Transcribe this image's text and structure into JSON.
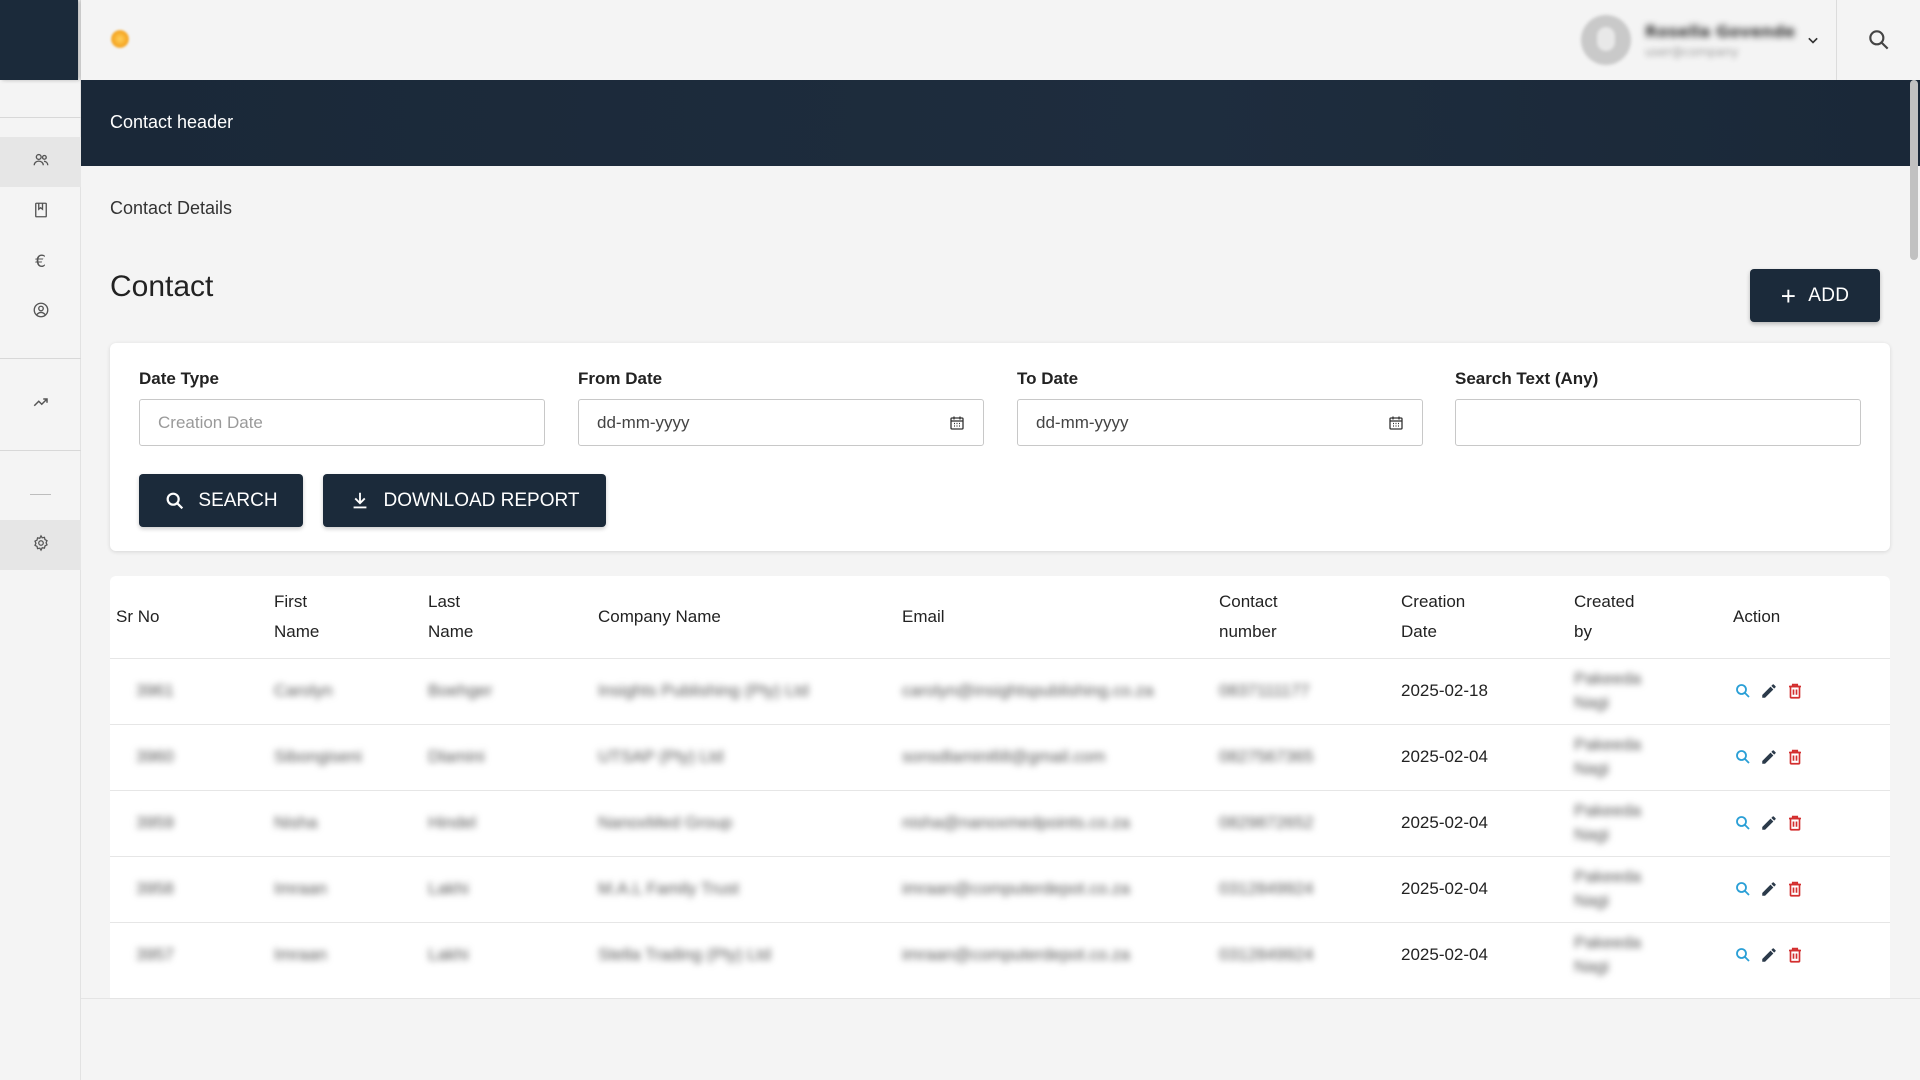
{
  "header": {
    "user_name": "Rosella Govender",
    "user_email": "user@company"
  },
  "banner": {
    "title": "Contact header"
  },
  "breadcrumb": "Contact Details",
  "page_title": "Contact",
  "add_button": {
    "label": "ADD"
  },
  "filters": {
    "date_type": {
      "label": "Date Type",
      "placeholder": "Creation Date"
    },
    "from_date": {
      "label": "From Date",
      "value": "dd-mm-yyyy"
    },
    "to_date": {
      "label": "To Date",
      "value": "dd-mm-yyyy"
    },
    "search_text": {
      "label": "Search Text (Any)",
      "value": ""
    },
    "search_button": "SEARCH",
    "download_button": "DOWNLOAD REPORT"
  },
  "table": {
    "columns": [
      {
        "l1": "Sr No",
        "l2": ""
      },
      {
        "l1": "First",
        "l2": "Name"
      },
      {
        "l1": "Last",
        "l2": "Name"
      },
      {
        "l1": "Company Name",
        "l2": ""
      },
      {
        "l1": "Email",
        "l2": ""
      },
      {
        "l1": "Contact",
        "l2": "number"
      },
      {
        "l1": "Creation",
        "l2": "Date"
      },
      {
        "l1": "Created",
        "l2": "by"
      },
      {
        "l1": "Action",
        "l2": ""
      }
    ],
    "rows": [
      {
        "sr": "3961",
        "first": "Carolyn",
        "last": "Boehger",
        "company": "Insights Publishing (Pty) Ltd",
        "email": "carolyn@insightspublishing.co.za",
        "contact": "0837111177",
        "date": "2025-02-18",
        "by1": "Pakeeda",
        "by2": "Nagi"
      },
      {
        "sr": "3960",
        "first": "Sibongiseni",
        "last": "Dlamini",
        "company": "UTSAP (Pty) Ltd",
        "email": "sonsdlamini68@gmail.com",
        "contact": "0827567365",
        "date": "2025-02-04",
        "by1": "Pakeeda",
        "by2": "Nagi"
      },
      {
        "sr": "3959",
        "first": "Nisha",
        "last": "Hindel",
        "company": "NanoxMed Group",
        "email": "nisha@nanoxmedpoints.co.za",
        "contact": "0829872652",
        "date": "2025-02-04",
        "by1": "Pakeeda",
        "by2": "Nagi"
      },
      {
        "sr": "3958",
        "first": "Imraan",
        "last": "Lakhi",
        "company": "M.A.L Family Trust",
        "email": "imraan@computerdepot.co.za",
        "contact": "0312849924",
        "date": "2025-02-04",
        "by1": "Pakeeda",
        "by2": "Nagi"
      },
      {
        "sr": "3957",
        "first": "Imraan",
        "last": "Lakhi",
        "company": "Stella Trading (Pty) Ltd",
        "email": "imraan@computerdepot.co.za",
        "contact": "0312849924",
        "date": "2025-02-04",
        "by1": "Pakeeda",
        "by2": "Nagi"
      }
    ]
  },
  "colors": {
    "primary": "#1b2a3a",
    "action_view": "#2a9fd6",
    "action_edit": "#2b3a4a",
    "action_delete": "#d32f2f"
  },
  "icons": {
    "sidebar": [
      "people-icon",
      "book-icon",
      "euro-icon",
      "account-circle-icon",
      "trending-up-icon",
      "settings-icon"
    ],
    "actions": [
      "search-icon",
      "edit-icon",
      "delete-icon"
    ]
  }
}
